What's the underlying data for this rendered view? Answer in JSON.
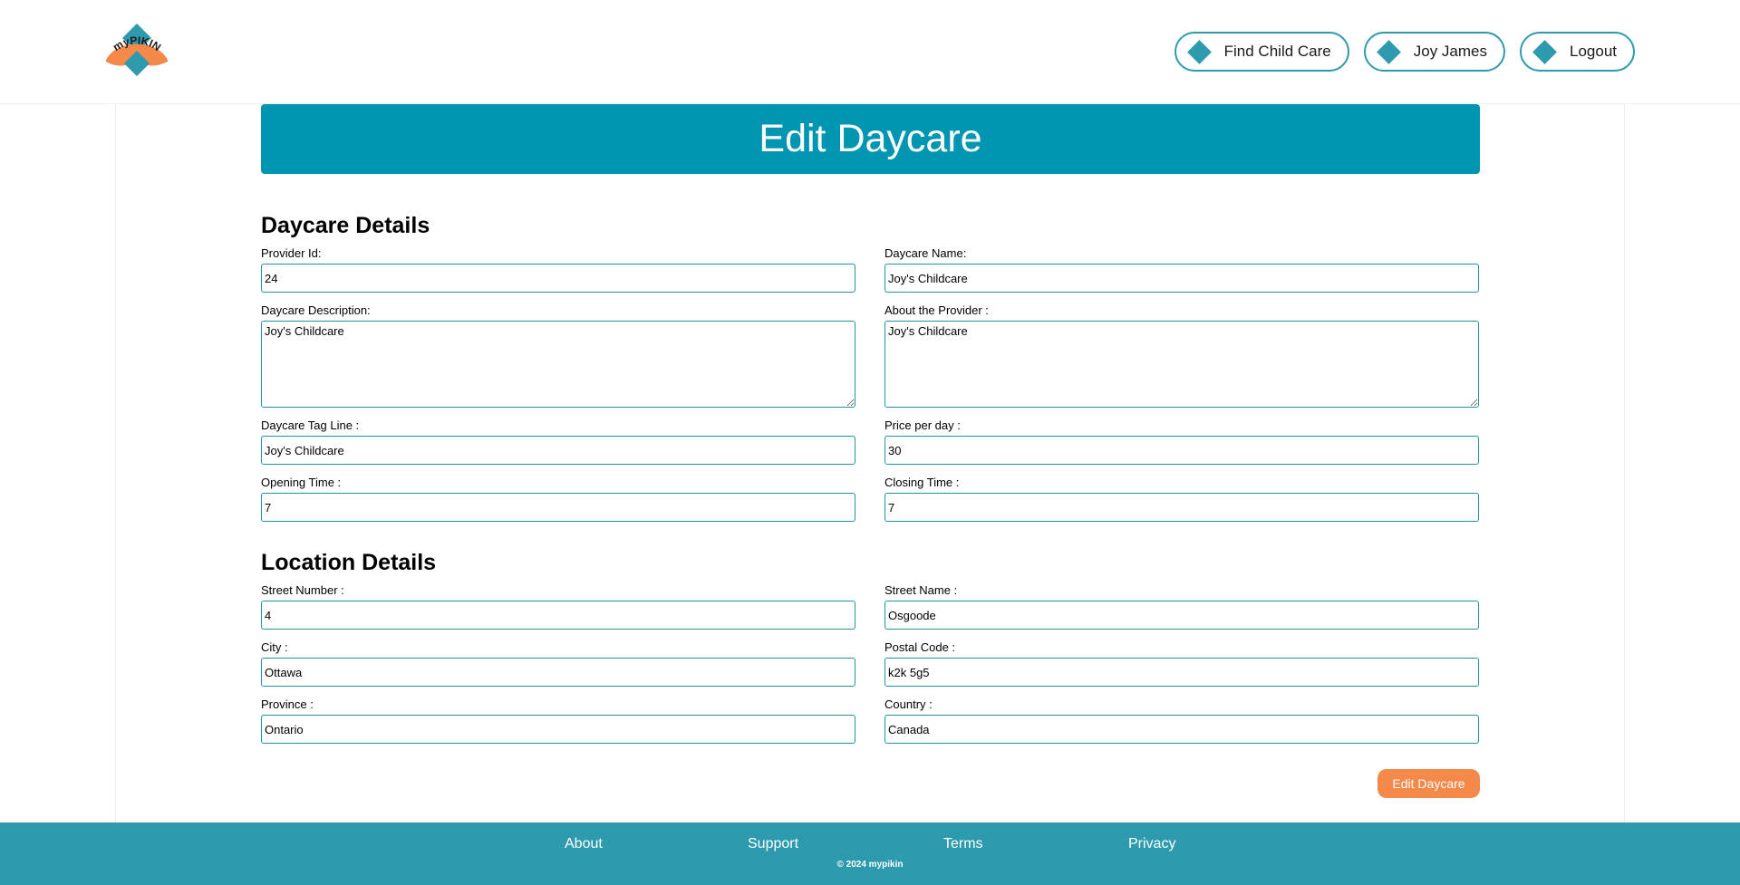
{
  "header": {
    "logo_text": "myPIKIN",
    "nav": [
      {
        "label": "Find Child Care",
        "icon": "diamond-icon"
      },
      {
        "label": "Joy James",
        "icon": "diamond-icon"
      },
      {
        "label": "Logout",
        "icon": "diamond-icon"
      }
    ]
  },
  "page": {
    "title": "Edit Daycare"
  },
  "daycare_details": {
    "title": "Daycare Details",
    "provider_id": {
      "label": "Provider Id:",
      "value": "24"
    },
    "daycare_name": {
      "label": "Daycare Name:",
      "value": "Joy's Childcare"
    },
    "description": {
      "label": "Daycare Description:",
      "value": "Joy's Childcare"
    },
    "about_provider": {
      "label": "About the Provider :",
      "value": "Joy's Childcare"
    },
    "tag_line": {
      "label": "Daycare Tag Line :",
      "value": "Joy's Childcare"
    },
    "price_per_day": {
      "label": "Price per day :",
      "value": "30"
    },
    "opening_time": {
      "label": "Opening Time :",
      "value": "7"
    },
    "closing_time": {
      "label": "Closing Time :",
      "value": "7"
    }
  },
  "location_details": {
    "title": "Location Details",
    "street_number": {
      "label": "Street Number :",
      "value": "4"
    },
    "street_name": {
      "label": "Street Name :",
      "value": "Osgoode"
    },
    "city": {
      "label": "City :",
      "value": "Ottawa"
    },
    "postal_code": {
      "label": "Postal Code :",
      "value": "k2k 5g5"
    },
    "province": {
      "label": "Province :",
      "value": "Ontario"
    },
    "country": {
      "label": "Country :",
      "value": "Canada"
    }
  },
  "submit_label": "Edit Daycare",
  "footer": {
    "links": [
      "About",
      "Support",
      "Terms",
      "Privacy"
    ],
    "copyright": "© 2024 mypikin"
  },
  "colors": {
    "accent": "#0096b2",
    "border": "#2196a8",
    "footer": "#2e9aae",
    "button": "#f5894a",
    "logo_orange": "#f5894a"
  }
}
